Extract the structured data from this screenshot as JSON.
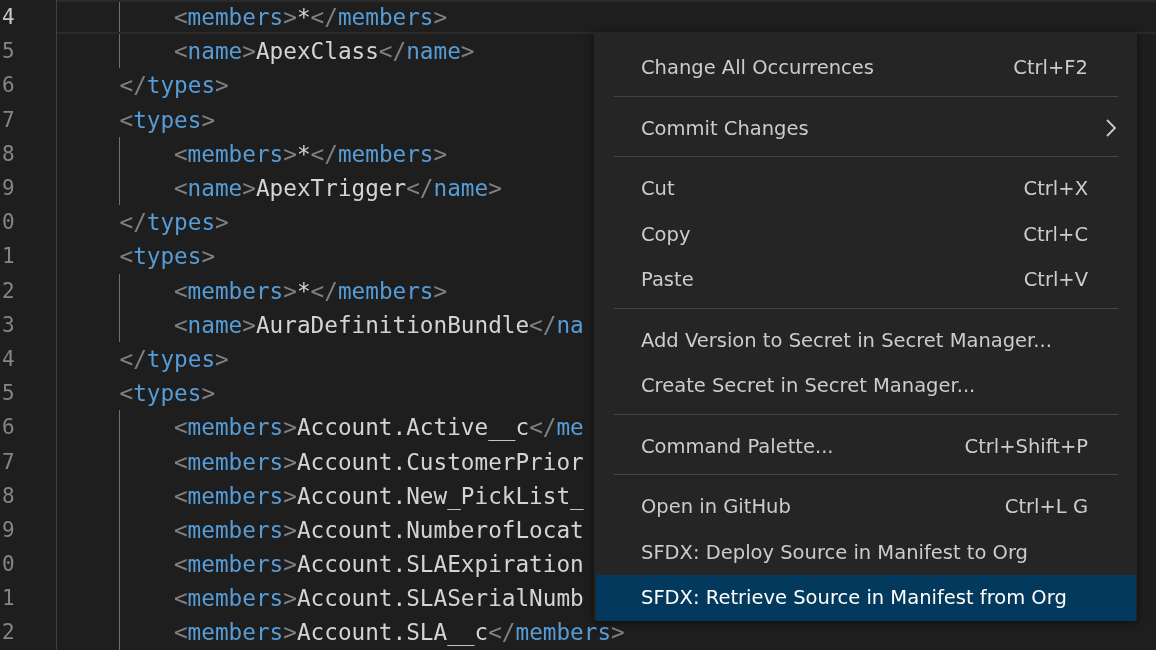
{
  "editor": {
    "lines": [
      {
        "number": "4",
        "text": "        <members>*</members>",
        "current": true
      },
      {
        "number": "5",
        "text": "        <name>ApexClass</name>",
        "current": false
      },
      {
        "number": "6",
        "text": "    </types>",
        "current": false
      },
      {
        "number": "7",
        "text": "    <types>",
        "current": false
      },
      {
        "number": "8",
        "text": "        <members>*</members>",
        "current": false
      },
      {
        "number": "9",
        "text": "        <name>ApexTrigger</name>",
        "current": false
      },
      {
        "number": "0",
        "text": "    </types>",
        "current": false
      },
      {
        "number": "1",
        "text": "    <types>",
        "current": false
      },
      {
        "number": "2",
        "text": "        <members>*</members>",
        "current": false
      },
      {
        "number": "3",
        "text": "        <name>AuraDefinitionBundle</na",
        "current": false
      },
      {
        "number": "4",
        "text": "    </types>",
        "current": false
      },
      {
        "number": "5",
        "text": "    <types>",
        "current": false
      },
      {
        "number": "6",
        "text": "        <members>Account.Active__c</me",
        "current": false
      },
      {
        "number": "7",
        "text": "        <members>Account.CustomerPrior",
        "current": false
      },
      {
        "number": "8",
        "text": "        <members>Account.New_PickList_",
        "current": false
      },
      {
        "number": "9",
        "text": "        <members>Account.NumberofLocat",
        "current": false
      },
      {
        "number": "0",
        "text": "        <members>Account.SLAExpiration",
        "current": false
      },
      {
        "number": "1",
        "text": "        <members>Account.SLASerialNumb",
        "current": false
      },
      {
        "number": "2",
        "text": "        <members>Account.SLA__c</members>",
        "current": false
      }
    ]
  },
  "context_menu": {
    "items": [
      {
        "kind": "item",
        "label": "Change All Occurrences",
        "shortcut": "Ctrl+F2",
        "submenu": false,
        "selected": false
      },
      {
        "kind": "separator"
      },
      {
        "kind": "item",
        "label": "Commit Changes",
        "submenu": true,
        "selected": false
      },
      {
        "kind": "separator"
      },
      {
        "kind": "item",
        "label": "Cut",
        "shortcut": "Ctrl+X",
        "submenu": false,
        "selected": false
      },
      {
        "kind": "item",
        "label": "Copy",
        "shortcut": "Ctrl+C",
        "submenu": false,
        "selected": false
      },
      {
        "kind": "item",
        "label": "Paste",
        "shortcut": "Ctrl+V",
        "submenu": false,
        "selected": false
      },
      {
        "kind": "separator"
      },
      {
        "kind": "item",
        "label": "Add Version to Secret in Secret Manager...",
        "submenu": false,
        "selected": false
      },
      {
        "kind": "item",
        "label": "Create Secret in Secret Manager...",
        "submenu": false,
        "selected": false
      },
      {
        "kind": "separator"
      },
      {
        "kind": "item",
        "label": "Command Palette...",
        "shortcut": "Ctrl+Shift+P",
        "submenu": false,
        "selected": false
      },
      {
        "kind": "separator"
      },
      {
        "kind": "item",
        "label": "Open in GitHub",
        "shortcut": "Ctrl+L G",
        "submenu": false,
        "selected": false
      },
      {
        "kind": "item",
        "label": "SFDX: Deploy Source in Manifest to Org",
        "submenu": false,
        "selected": false
      },
      {
        "kind": "item",
        "label": "SFDX: Retrieve Source in Manifest from Org",
        "submenu": false,
        "selected": true
      }
    ]
  }
}
